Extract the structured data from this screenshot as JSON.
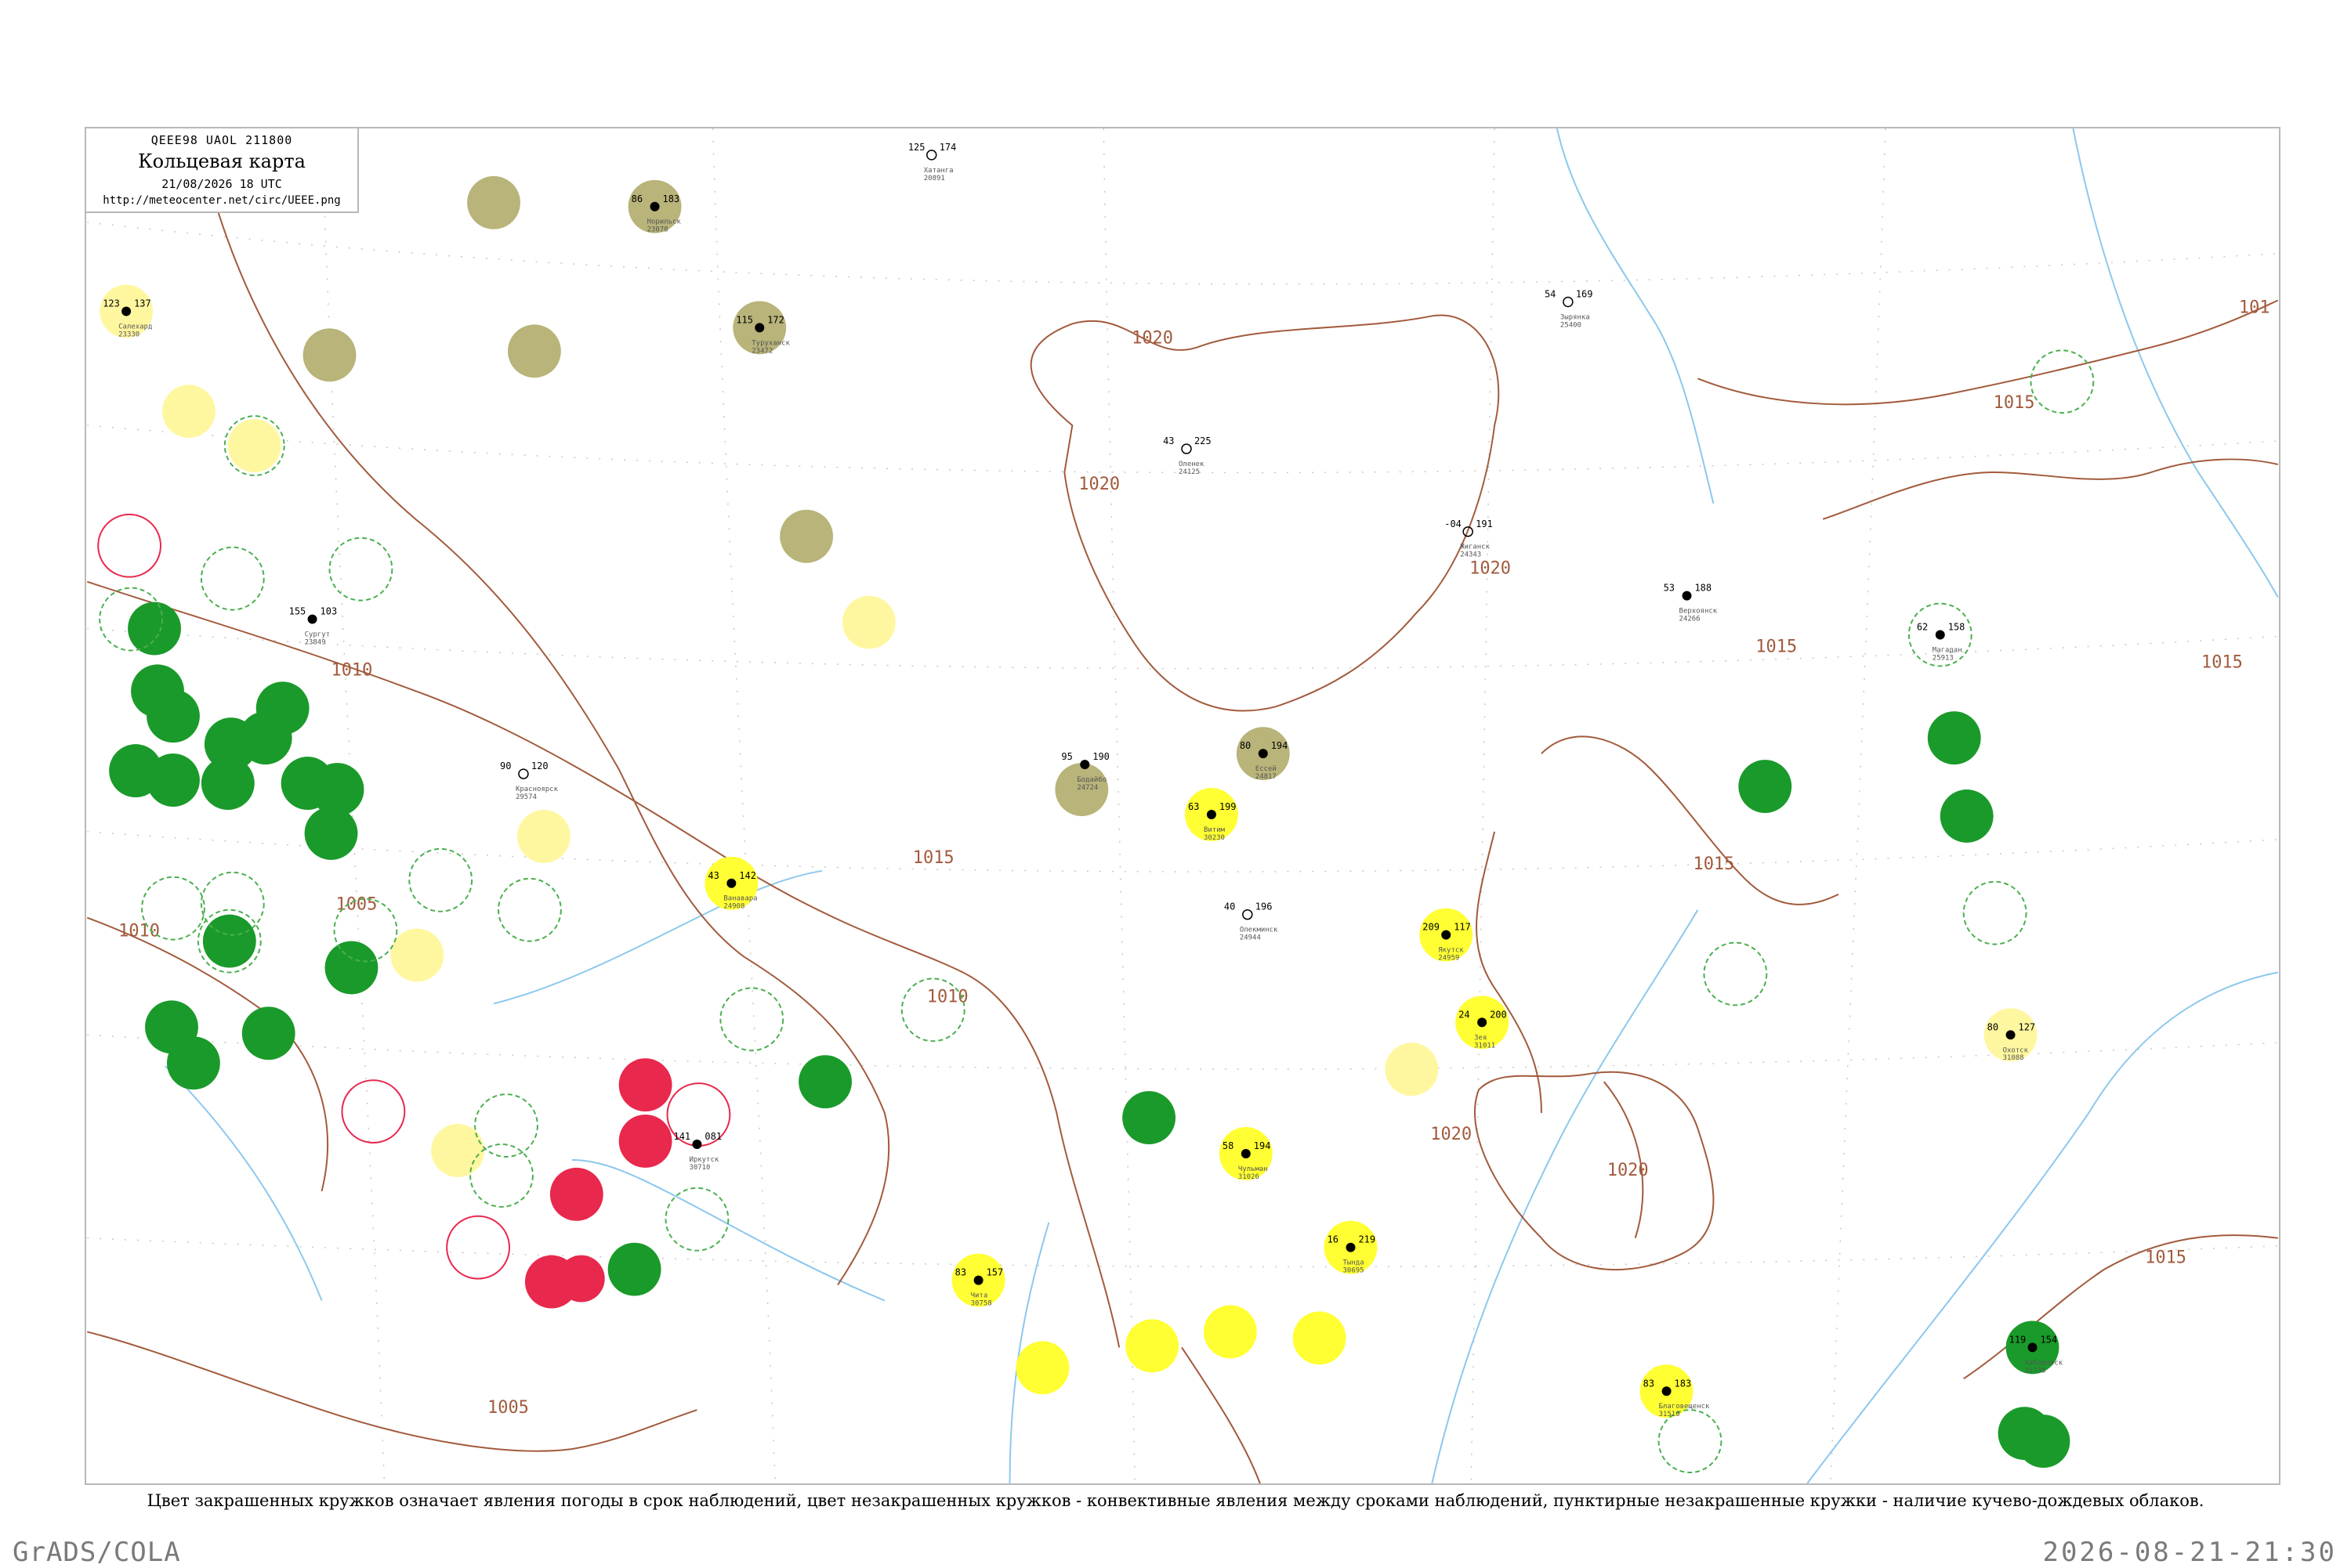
{
  "header": {
    "code": "QEEE98 UAOL 211800",
    "title": "Кольцевая карта",
    "date": "21/08/2026 18 UTC",
    "url": "http://meteocenter.net/circ/UEEE.png"
  },
  "legend_note": "Цвет закрашенных кружков означает явления погоды в срок наблюдений, цвет незакрашенных кружков - конвективные явления между сроками наблюдений, пунктирные незакрашенные кружки - наличие кучево-дождевых облаков.",
  "footer": {
    "left": "GrADS/COLA",
    "right": "2026-08-21-21:30"
  },
  "colors": {
    "isobar": "#a25a3c",
    "river": "#8cc8ec",
    "green": "#1a9a2a",
    "yellow": "#ffff33",
    "pale_yellow": "#fff7a0",
    "olive": "#b8b47a",
    "red": "#e8284c",
    "dashed_ring": "#4caf50"
  },
  "isobar_labels": [
    "1020",
    "1020",
    "1020",
    "1015",
    "1015",
    "1015",
    "1015",
    "1015",
    "1010",
    "1010",
    "1010",
    "1005",
    "1005",
    "1020",
    "1020",
    "1015",
    "101"
  ],
  "stations": [
    {
      "name": "Жиганск",
      "id": "24343",
      "temp": "191",
      "dew": "-04"
    },
    {
      "name": "Верхоянск",
      "id": "24266",
      "temp": "188",
      "dew": "53"
    },
    {
      "name": "Оленек",
      "id": "24125",
      "temp": "225",
      "dew": "43"
    },
    {
      "name": "Хатанга",
      "id": "20891",
      "temp": "174",
      "dew": "125"
    },
    {
      "name": "Ессей",
      "id": "24817",
      "temp": "194",
      "dew": "80"
    },
    {
      "name": "Туруханск",
      "id": "23472",
      "temp": "172",
      "dew": "115"
    },
    {
      "name": "Ванавара",
      "id": "24908",
      "temp": "142",
      "dew": "43"
    },
    {
      "name": "Витим",
      "id": "30230",
      "temp": "199",
      "dew": "63"
    },
    {
      "name": "Бодайбо",
      "id": "24724",
      "temp": "190",
      "dew": "95"
    },
    {
      "name": "Олекминск",
      "id": "24944",
      "temp": "196",
      "dew": "40"
    },
    {
      "name": "Якутск",
      "id": "24959",
      "temp": "117",
      "dew": "209"
    },
    {
      "name": "Чульман",
      "id": "31026",
      "temp": "194",
      "dew": "58"
    },
    {
      "name": "Тында",
      "id": "30695",
      "temp": "219",
      "dew": "16"
    },
    {
      "name": "Зея",
      "id": "31011",
      "temp": "200",
      "dew": "24"
    },
    {
      "name": "Охотск",
      "id": "31088",
      "temp": "127",
      "dew": "80"
    },
    {
      "name": "Магадан",
      "id": "25913",
      "temp": "158",
      "dew": "62"
    },
    {
      "name": "Зырянка",
      "id": "25400",
      "temp": "169",
      "dew": "54"
    },
    {
      "name": "Иркутск",
      "id": "30710",
      "temp": "081",
      "dew": "141"
    },
    {
      "name": "Чита",
      "id": "30758",
      "temp": "157",
      "dew": "83"
    },
    {
      "name": "Благовещенск",
      "id": "31510",
      "temp": "183",
      "dew": "83"
    },
    {
      "name": "Хабаровск",
      "id": "31735",
      "temp": "154",
      "dew": "119"
    },
    {
      "name": "Салехард",
      "id": "23330",
      "temp": "137",
      "dew": "123"
    },
    {
      "name": "Сургут",
      "id": "23849",
      "temp": "103",
      "dew": "155"
    },
    {
      "name": "Красноярск",
      "id": "29574",
      "temp": "120",
      "dew": "90"
    },
    {
      "name": "Норильск",
      "id": "23078",
      "temp": "183",
      "dew": "86"
    }
  ]
}
